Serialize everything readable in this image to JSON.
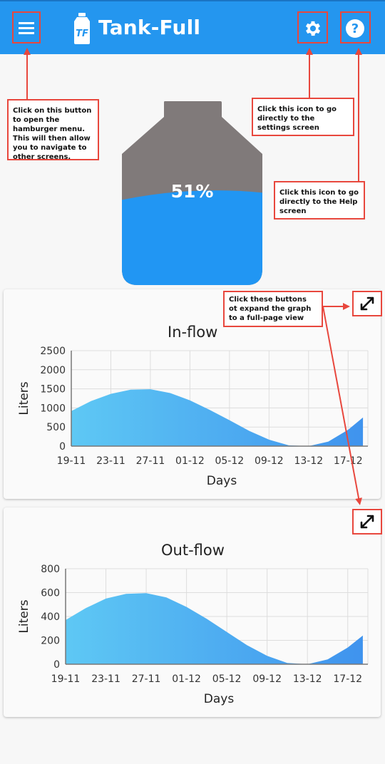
{
  "app": {
    "title": "Tank-Full",
    "logo_text": "TF",
    "accent": "#2496ef"
  },
  "tank": {
    "level_percent": 51,
    "level_label": "51%",
    "fill_color": "#2196f3",
    "empty_color": "#807a7a"
  },
  "annotations": {
    "menu": "Click on this button to open the hamburger menu. This will then allow you to navigate to other screens.",
    "settings": "Click this icon to go directly to the settings screen",
    "help": "Click this icon to go directly to the Help screen",
    "expand": "Click these buttons ot expand the graph to a full-page view"
  },
  "icons": {
    "menu": "menu-icon",
    "settings": "gear-icon",
    "help": "help-icon",
    "expand": "expand-icon"
  },
  "chart_data": [
    {
      "type": "area",
      "title": "In-flow",
      "xlabel": "Days",
      "ylabel": "Liters",
      "x_ticks": [
        "19-11",
        "23-11",
        "27-11",
        "01-12",
        "05-12",
        "09-12",
        "13-12",
        "17-12"
      ],
      "y_ticks": [
        0,
        500,
        1000,
        1500,
        2000,
        2500
      ],
      "ylim": [
        0,
        2500
      ],
      "x": [
        0,
        2,
        4,
        6,
        8,
        10,
        12,
        14,
        16,
        18,
        20,
        22,
        24,
        26,
        28,
        29.5
      ],
      "values": [
        920,
        1180,
        1370,
        1480,
        1490,
        1390,
        1200,
        950,
        680,
        400,
        170,
        20,
        0,
        120,
        430,
        750
      ],
      "grid": true
    },
    {
      "type": "area",
      "title": "Out-flow",
      "xlabel": "Days",
      "ylabel": "Liters",
      "x_ticks": [
        "19-11",
        "23-11",
        "27-11",
        "01-12",
        "05-12",
        "09-12",
        "13-12",
        "17-12"
      ],
      "y_ticks": [
        0,
        200,
        400,
        600,
        800
      ],
      "ylim": [
        0,
        800
      ],
      "x": [
        0,
        2,
        4,
        6,
        8,
        10,
        12,
        14,
        16,
        18,
        20,
        22,
        24,
        26,
        28,
        29.5
      ],
      "values": [
        370,
        470,
        550,
        590,
        595,
        560,
        480,
        380,
        270,
        160,
        70,
        10,
        0,
        40,
        140,
        240
      ],
      "grid": true
    }
  ]
}
